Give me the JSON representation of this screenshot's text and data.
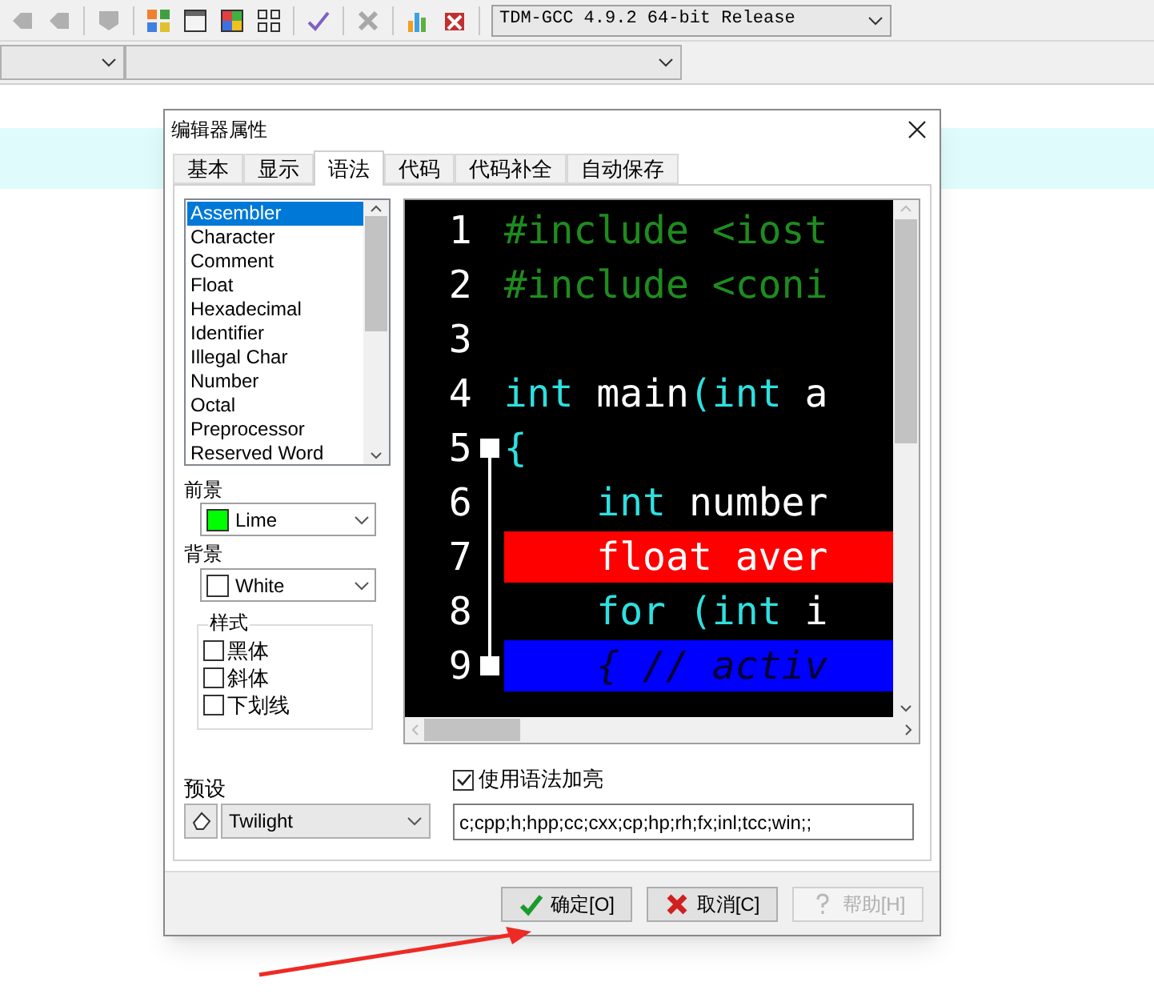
{
  "toolbar": {
    "compiler": "TDM-GCC 4.9.2 64-bit Release"
  },
  "dialog": {
    "title": "编辑器属性",
    "tabs": [
      {
        "label": "基本",
        "selected": false
      },
      {
        "label": "显示",
        "selected": false
      },
      {
        "label": "语法",
        "selected": true
      },
      {
        "label": "代码",
        "selected": false
      },
      {
        "label": "代码补全",
        "selected": false
      },
      {
        "label": "自动保存",
        "selected": false
      }
    ],
    "elements": [
      {
        "label": "Assembler",
        "selected": true
      },
      {
        "label": "Character",
        "selected": false
      },
      {
        "label": "Comment",
        "selected": false
      },
      {
        "label": "Float",
        "selected": false
      },
      {
        "label": "Hexadecimal",
        "selected": false
      },
      {
        "label": "Identifier",
        "selected": false
      },
      {
        "label": "Illegal Char",
        "selected": false
      },
      {
        "label": "Number",
        "selected": false
      },
      {
        "label": "Octal",
        "selected": false
      },
      {
        "label": "Preprocessor",
        "selected": false
      },
      {
        "label": "Reserved Word",
        "selected": false
      }
    ],
    "foreground": {
      "label": "前景",
      "value": "Lime",
      "color": "#00ff00"
    },
    "background": {
      "label": "背景",
      "value": "White",
      "color": "#ffffff"
    },
    "style": {
      "title": "样式",
      "options": [
        {
          "label": "黑体",
          "checked": false
        },
        {
          "label": "斜体",
          "checked": false
        },
        {
          "label": "下划线",
          "checked": false
        }
      ]
    },
    "editor": {
      "lines": [
        {
          "number": "1",
          "segments": [
            {
              "text": "#include <iost",
              "kind": "preprocessor"
            }
          ]
        },
        {
          "number": "2",
          "segments": [
            {
              "text": "#include <coni",
              "kind": "preprocessor"
            }
          ]
        },
        {
          "number": "3"
        },
        {
          "number": "4",
          "segments": [
            {
              "text": "int",
              "kind": "keyword"
            },
            {
              "text": " main",
              "kind": "plain"
            },
            {
              "text": "(int",
              "kind": "keyword"
            },
            {
              "text": " a",
              "kind": "plain"
            }
          ]
        },
        {
          "number": "5",
          "fold_marker": true,
          "segments": [
            {
              "text": "{",
              "kind": "keyword"
            }
          ]
        },
        {
          "number": "6",
          "segments": [
            {
              "text": "    int",
              "kind": "keyword"
            },
            {
              "text": " number",
              "kind": "plain"
            }
          ]
        },
        {
          "number": "7",
          "color": "#ff0000",
          "segments": [
            {
              "text": "    float aver",
              "kind": "plain"
            }
          ]
        },
        {
          "number": "8",
          "segments": [
            {
              "text": "    for (int",
              "kind": "keyword"
            },
            {
              "text": " i",
              "kind": "plain"
            }
          ]
        },
        {
          "number": "9",
          "fold_marker": true,
          "color": "#0000ff",
          "segments": [
            {
              "text": "    { // activ",
              "kind": "comment"
            }
          ]
        }
      ]
    },
    "syntax_highlight": {
      "label": "使用语法加亮",
      "checked": true
    },
    "preset": {
      "label": "预设",
      "value": "Twilight"
    },
    "extensions": {
      "value": "c;cpp;h;hpp;cc;cxx;cp;hp;rh;fx;inl;tcc;win;;"
    },
    "buttons": [
      {
        "label": "确定[O]",
        "kind": "ok",
        "disabled": false
      },
      {
        "label": "取消[C]",
        "kind": "cancel",
        "disabled": false
      },
      {
        "label": "帮助[H]",
        "kind": "help",
        "disabled": true
      }
    ]
  }
}
